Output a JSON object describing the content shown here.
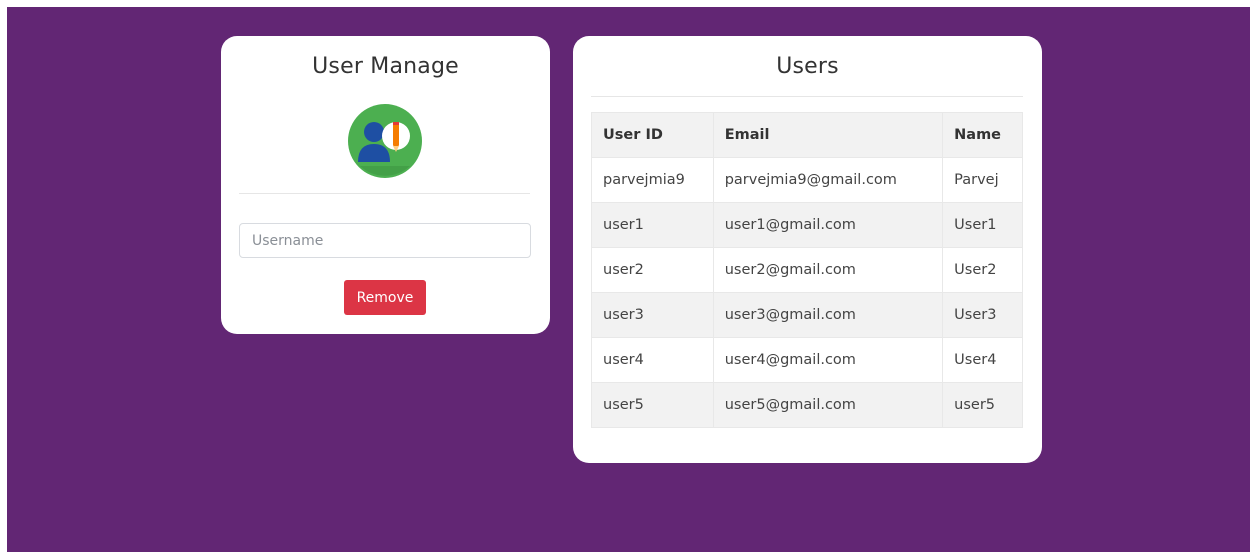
{
  "manage_card": {
    "title": "User Manage",
    "avatar_icon": "user-edit-icon",
    "username_placeholder": "Username",
    "username_value": "",
    "remove_label": "Remove"
  },
  "users_card": {
    "title": "Users",
    "columns": [
      "User ID",
      "Email",
      "Name"
    ],
    "rows": [
      {
        "id": "parvejmia9",
        "email": "parvejmia9@gmail.com",
        "name": "Parvej"
      },
      {
        "id": "user1",
        "email": "user1@gmail.com",
        "name": "User1"
      },
      {
        "id": "user2",
        "email": "user2@gmail.com",
        "name": "User2"
      },
      {
        "id": "user3",
        "email": "user3@gmail.com",
        "name": "User3"
      },
      {
        "id": "user4",
        "email": "user4@gmail.com",
        "name": "User4"
      },
      {
        "id": "user5",
        "email": "user5@gmail.com",
        "name": "user5"
      }
    ]
  },
  "colors": {
    "background": "#622674",
    "card": "#ffffff",
    "danger": "#dc3545"
  }
}
